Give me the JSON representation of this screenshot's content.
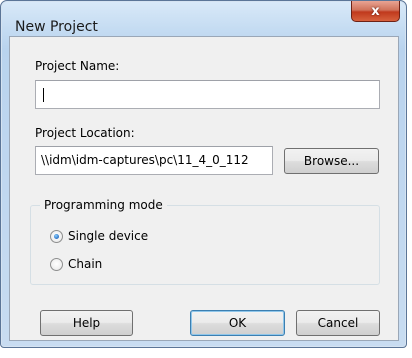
{
  "window": {
    "title": "New Project",
    "close_glyph": "x"
  },
  "form": {
    "project_name": {
      "label": "Project Name:",
      "value": ""
    },
    "project_location": {
      "label": "Project Location:",
      "value": "\\\\idm\\idm-captures\\pc\\11_4_0_112",
      "browse_label": "Browse..."
    },
    "programming_mode": {
      "title": "Programming mode",
      "options": [
        {
          "label": "Single device",
          "checked": true
        },
        {
          "label": "Chain",
          "checked": false
        }
      ]
    }
  },
  "buttons": {
    "help": "Help",
    "ok": "OK",
    "cancel": "Cancel"
  },
  "colors": {
    "frame": "#c5dcf2",
    "client": "#f0f0f0",
    "close": "#c0391d",
    "default_button_border": "#3c7fb1"
  }
}
